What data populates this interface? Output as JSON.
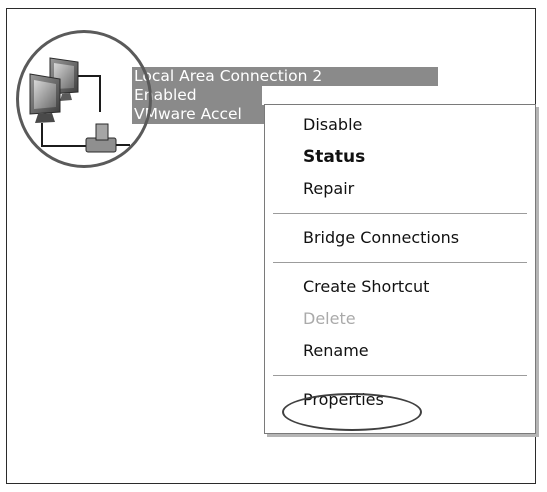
{
  "connection": {
    "name": "Local Area Connection 2",
    "status": "Enabled",
    "device": "VMware Accel",
    "icon": "network-connection-icon"
  },
  "context_menu": {
    "items": [
      {
        "label": "Disable",
        "style": "normal"
      },
      {
        "label": "Status",
        "style": "bold"
      },
      {
        "label": "Repair",
        "style": "normal"
      },
      {
        "label": "Bridge Connections",
        "style": "normal"
      },
      {
        "label": "Create Shortcut",
        "style": "normal"
      },
      {
        "label": "Delete",
        "style": "disabled"
      },
      {
        "label": "Rename",
        "style": "normal"
      },
      {
        "label": "Properties",
        "style": "normal"
      }
    ]
  },
  "colors": {
    "selection": "#8a8a8a",
    "annotation": "#5a5a5a"
  }
}
